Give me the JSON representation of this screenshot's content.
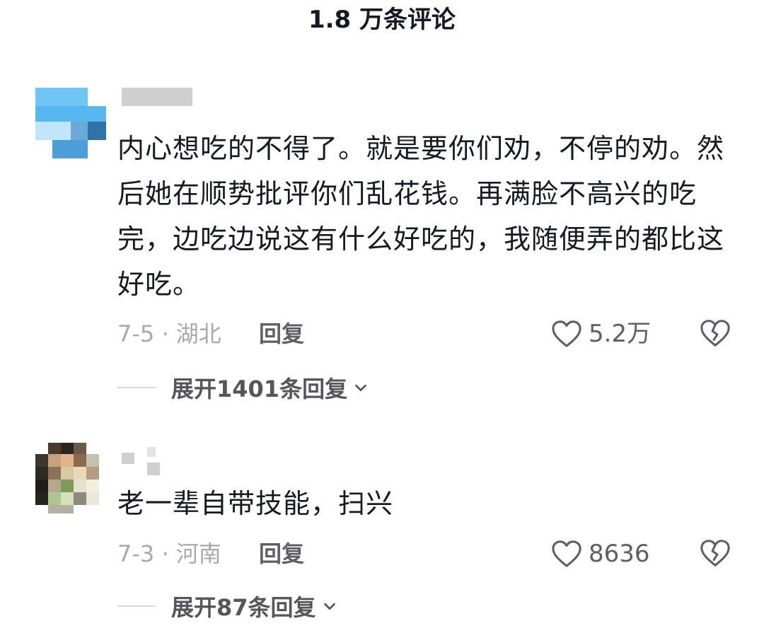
{
  "header": {
    "title": "1.8 万条评论"
  },
  "comments": [
    {
      "text": "内心想吃的不得了。就是要你们劝，不停的劝。然后她在顺势批评你们乱花钱。再满脸不高兴的吃完，边吃边说这有什么好吃的，我随便弄的都比这好吃。",
      "date_location": "7-5 · 湖北",
      "reply_label": "回复",
      "like_count": "5.2万",
      "expand_label": "展开1401条回复"
    },
    {
      "text": "老一辈自带技能，扫兴",
      "date_location": "7-3 · 河南",
      "reply_label": "回复",
      "like_count": "8636",
      "expand_label": "展开87条回复"
    }
  ],
  "colors": {
    "text_primary": "#161823",
    "text_secondary": "#a8a8ae",
    "text_action": "#5e5e66"
  },
  "icons": {
    "like": "heart-outline-icon",
    "dislike": "broken-heart-icon",
    "expand": "chevron-down-icon"
  }
}
